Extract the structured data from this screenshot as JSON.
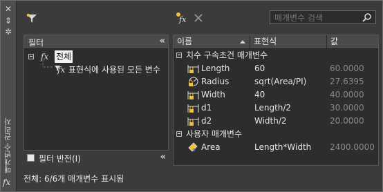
{
  "sidebar": {
    "title": "매개변수 관리자",
    "fx_label": "fx",
    "close_glyph": "✕",
    "pin_glyph": "⇕",
    "settings_glyph": "✲"
  },
  "toolbar": {
    "search_placeholder": "매개변수 검색",
    "fx_label": "fx"
  },
  "filter_panel": {
    "header": "필터",
    "collapse_glyph": "«",
    "tree": {
      "root": {
        "fx": "fx",
        "label": "전체"
      },
      "child": {
        "fx": "fx",
        "label": "표현식에 사용된 모든 변수"
      }
    },
    "invert_label": "필터 반전(I)"
  },
  "params_grid": {
    "collapse_glyph": "«",
    "columns": [
      "이름",
      "표현식",
      "값"
    ],
    "groups": [
      {
        "label": "치수 구속조건 매개변수",
        "rows": [
          {
            "icon": "lock-linear-dim-icon",
            "name": "Length",
            "expr": "60",
            "value": "60.0000"
          },
          {
            "icon": "lock-radius-icon",
            "name": "Radius",
            "expr": "sqrt(Area/PI)",
            "value": "27.6395"
          },
          {
            "icon": "lock-linear-dim-icon",
            "name": "Width",
            "expr": "40",
            "value": "40.0000"
          },
          {
            "icon": "lock-linear-dim-icon",
            "name": "d1",
            "expr": "Length/2",
            "value": "30.0000"
          },
          {
            "icon": "lock-linear-dim-icon",
            "name": "d2",
            "expr": "Width/2",
            "value": "20.0000"
          }
        ]
      },
      {
        "label": "사용자 매개변수",
        "rows": [
          {
            "icon": "user-parameter-icon",
            "name": "Area",
            "expr": "Length*Width",
            "value": "2400.0000"
          }
        ]
      }
    ]
  },
  "status": "전체: 6/6개 매개변수 표시됨"
}
